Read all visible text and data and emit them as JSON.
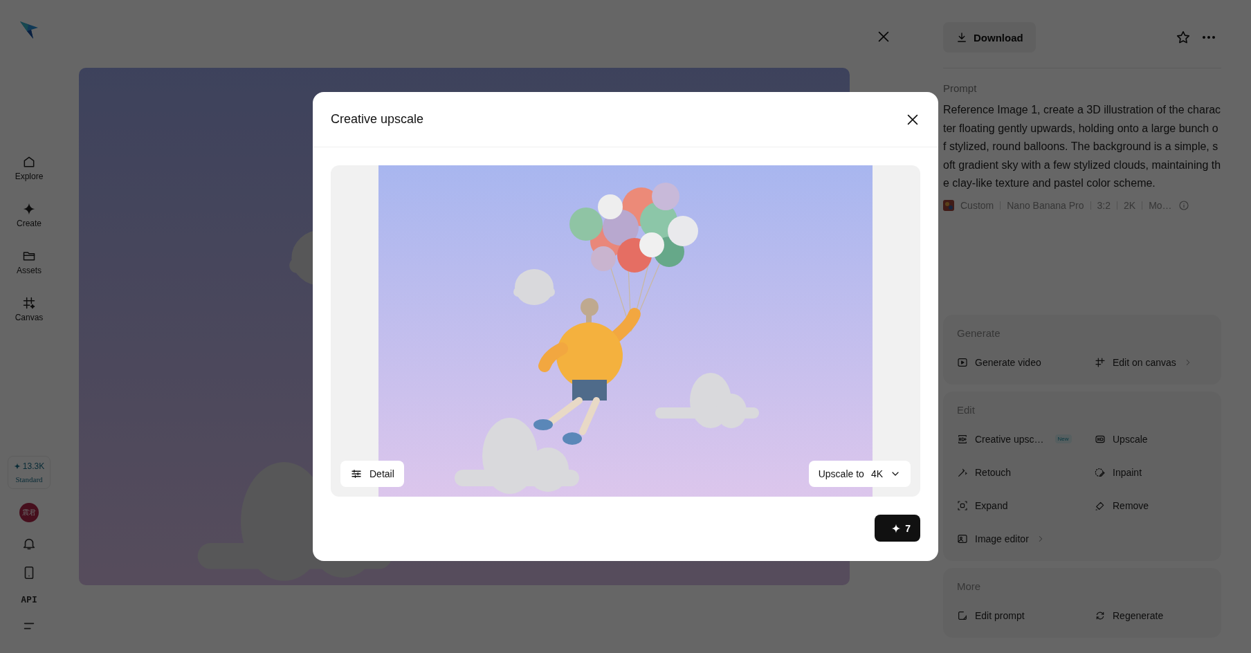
{
  "sidebar": {
    "nav": [
      {
        "label": "Explore"
      },
      {
        "label": "Create"
      },
      {
        "label": "Assets"
      },
      {
        "label": "Canvas"
      }
    ],
    "credits": {
      "amount": "13.3K",
      "plan": "Standard"
    },
    "avatar": "震君",
    "api": "API"
  },
  "panel": {
    "download": "Download",
    "prompt_label": "Prompt",
    "prompt": "Reference Image 1, create a 3D illustration of the character floating gently upwards, holding onto a large bunch of stylized, round balloons. The background is a simple, soft gradient sky with a few stylized clouds, maintaining the clay-like texture and pastel color scheme.",
    "meta": [
      "Custom",
      "Nano Banana Pro",
      "3:2",
      "2K",
      "Mo…"
    ],
    "sections": [
      {
        "title": "Generate",
        "items": [
          {
            "label": "Generate video",
            "submenu": false
          },
          {
            "label": "Edit on canvas",
            "submenu": true
          }
        ]
      },
      {
        "title": "Edit",
        "items": [
          {
            "label": "Creative upsc…",
            "badge": "New",
            "submenu": false
          },
          {
            "label": "Upscale",
            "submenu": false
          },
          {
            "label": "Retouch",
            "submenu": false
          },
          {
            "label": "Inpaint",
            "submenu": false
          },
          {
            "label": "Expand",
            "submenu": false
          },
          {
            "label": "Remove",
            "submenu": false
          },
          {
            "label": "Image editor",
            "submenu": true
          }
        ]
      },
      {
        "title": "More",
        "items": [
          {
            "label": "Edit prompt",
            "submenu": false
          },
          {
            "label": "Regenerate",
            "submenu": false
          }
        ]
      }
    ]
  },
  "modal": {
    "title": "Creative upscale",
    "detail": "Detail",
    "upscale_label": "Upscale to",
    "upscale_value": "4K",
    "cost": "7"
  }
}
